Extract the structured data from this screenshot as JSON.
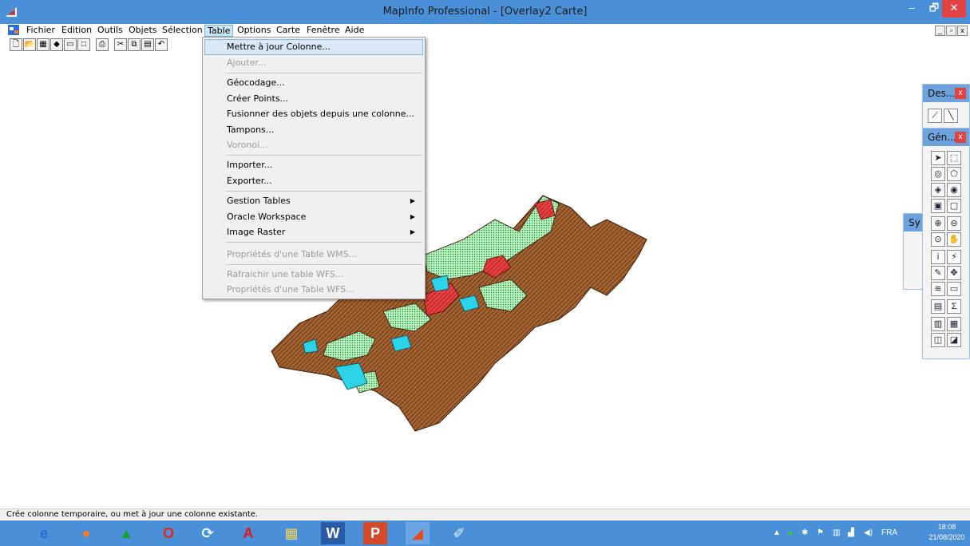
{
  "window": {
    "title": "MapInfo Professional - [Overlay2 Carte]",
    "min_glyph": "–",
    "max_glyph": "🗗",
    "close_glyph": "✕"
  },
  "menu": {
    "items": [
      "Fichier",
      "Edition",
      "Outils",
      "Objets",
      "Sélection",
      "Table",
      "Options",
      "Carte",
      "Fenêtre",
      "Aide"
    ],
    "active": "Table"
  },
  "mdi_buttons": [
    "_",
    "▫",
    "x"
  ],
  "table_menu": [
    {
      "label": "Mettre à jour Colonne...",
      "enabled": true
    },
    {
      "label": "Ajouter...",
      "enabled": false
    },
    {
      "label": "Géocodage...",
      "enabled": true
    },
    {
      "label": "Créer Points...",
      "enabled": true
    },
    {
      "label": "Fusionner des objets depuis une colonne...",
      "enabled": true
    },
    {
      "label": "Tampons...",
      "enabled": true
    },
    {
      "label": "Voronoi...",
      "enabled": false
    },
    {
      "label": "Importer...",
      "enabled": true
    },
    {
      "label": "Exporter...",
      "enabled": true
    },
    {
      "label": "Gestion Tables",
      "enabled": true,
      "submenu": true
    },
    {
      "label": "Oracle Workspace",
      "enabled": true,
      "submenu": true
    },
    {
      "label": "Image Raster",
      "enabled": true,
      "submenu": true
    },
    {
      "label": "Propriétés d'une Table WMS...",
      "enabled": false
    },
    {
      "label": "Rafraichir une table WFS...",
      "enabled": false
    },
    {
      "label": "Propriétés d'une Table WFS...",
      "enabled": false
    }
  ],
  "palettes": {
    "dessin": {
      "title": "Des...",
      "close": "x"
    },
    "general": {
      "title": "Gén...",
      "close": "x"
    },
    "symbole": {
      "title": "Sy"
    }
  },
  "status": {
    "message": "Crée colonne temporaire, ou met à jour une colonne existante."
  },
  "taskbar": {
    "apps": [
      "internet-explorer-icon",
      "firefox-icon",
      "triangle-app-icon",
      "opera-icon",
      "sync-app-icon",
      "acrobat-icon",
      "file-explorer-icon",
      "word-icon",
      "powerpoint-icon",
      "mapinfo-icon",
      "paint-icon"
    ],
    "language": "FRA",
    "time": "18:08",
    "date": "21/08/2020"
  },
  "colors": {
    "titlebar": "#4a90d9",
    "taskbar": "#4a90d9",
    "map_brown": "#9b5a2a",
    "map_green": "#9fe8a8",
    "map_cyan": "#2ad3e8",
    "map_red": "#e23a3a"
  }
}
